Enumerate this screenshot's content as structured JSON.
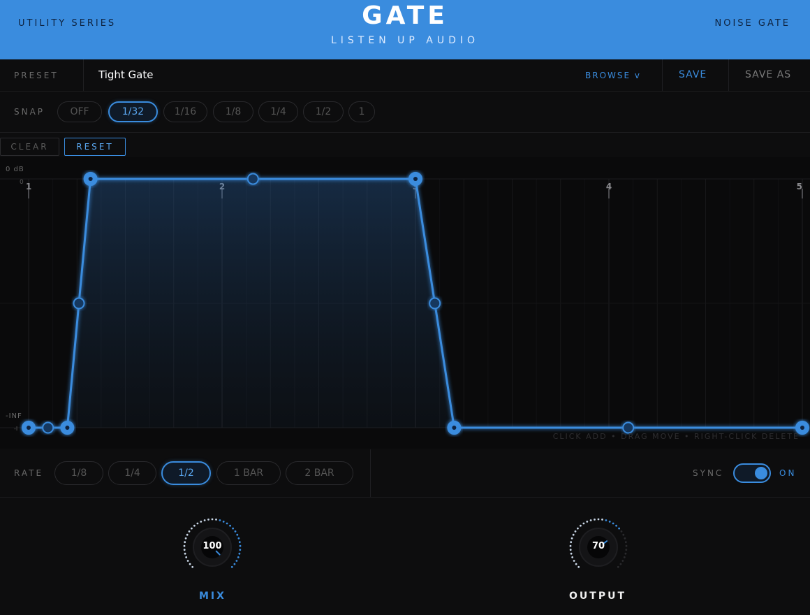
{
  "header": {
    "left_label": "UTILITY SERIES",
    "title": "GATE",
    "subtitle": "LISTEN UP AUDIO",
    "right_label": "NOISE GATE",
    "accent": "#3a8cde"
  },
  "preset": {
    "label": "PRESET",
    "name": "Tight Gate",
    "browse_label": "BROWSE v",
    "save_label": "SAVE",
    "save_as_label": "SAVE AS"
  },
  "snap": {
    "label": "SNAP",
    "options": [
      "OFF",
      "1/32",
      "1/16",
      "1/8",
      "1/4",
      "1/2",
      "1"
    ],
    "selected": "1/32"
  },
  "edit": {
    "clear_label": "CLEAR",
    "reset_label": "RESET"
  },
  "graph": {
    "y_top_label": "0 dB",
    "y_top_tick": "0",
    "y_bottom_label": "-INF",
    "y_bottom_tick": "-I",
    "beat_labels": [
      "1",
      "2",
      "3",
      "4",
      "5"
    ],
    "hint": "CLICK ADD • DRAG MOVE • RIGHT-CLICK DELETE",
    "envelope_points": [
      {
        "beat": 1.0,
        "level": 0,
        "type": "main"
      },
      {
        "beat": 1.1,
        "level": 0,
        "type": "mid"
      },
      {
        "beat": 1.2,
        "level": 0,
        "type": "main"
      },
      {
        "beat": 1.26,
        "level": 0.5,
        "type": "mid"
      },
      {
        "beat": 1.32,
        "level": 1,
        "type": "main"
      },
      {
        "beat": 2.16,
        "level": 1,
        "type": "mid"
      },
      {
        "beat": 3.0,
        "level": 1,
        "type": "main"
      },
      {
        "beat": 3.1,
        "level": 0.5,
        "type": "mid"
      },
      {
        "beat": 3.2,
        "level": 0,
        "type": "main"
      },
      {
        "beat": 4.1,
        "level": 0,
        "type": "mid"
      },
      {
        "beat": 5.0,
        "level": 0,
        "type": "main"
      }
    ]
  },
  "rate": {
    "label": "RATE",
    "options": [
      "1/8",
      "1/4",
      "1/2",
      "1 BAR",
      "2 BAR"
    ],
    "selected": "1/2",
    "sync_label": "SYNC",
    "sync_state": "ON"
  },
  "knobs": {
    "mix": {
      "label": "MIX",
      "value": "100",
      "level": 1.0
    },
    "output": {
      "label": "OUTPUT",
      "value": "70",
      "level": 0.7
    }
  }
}
